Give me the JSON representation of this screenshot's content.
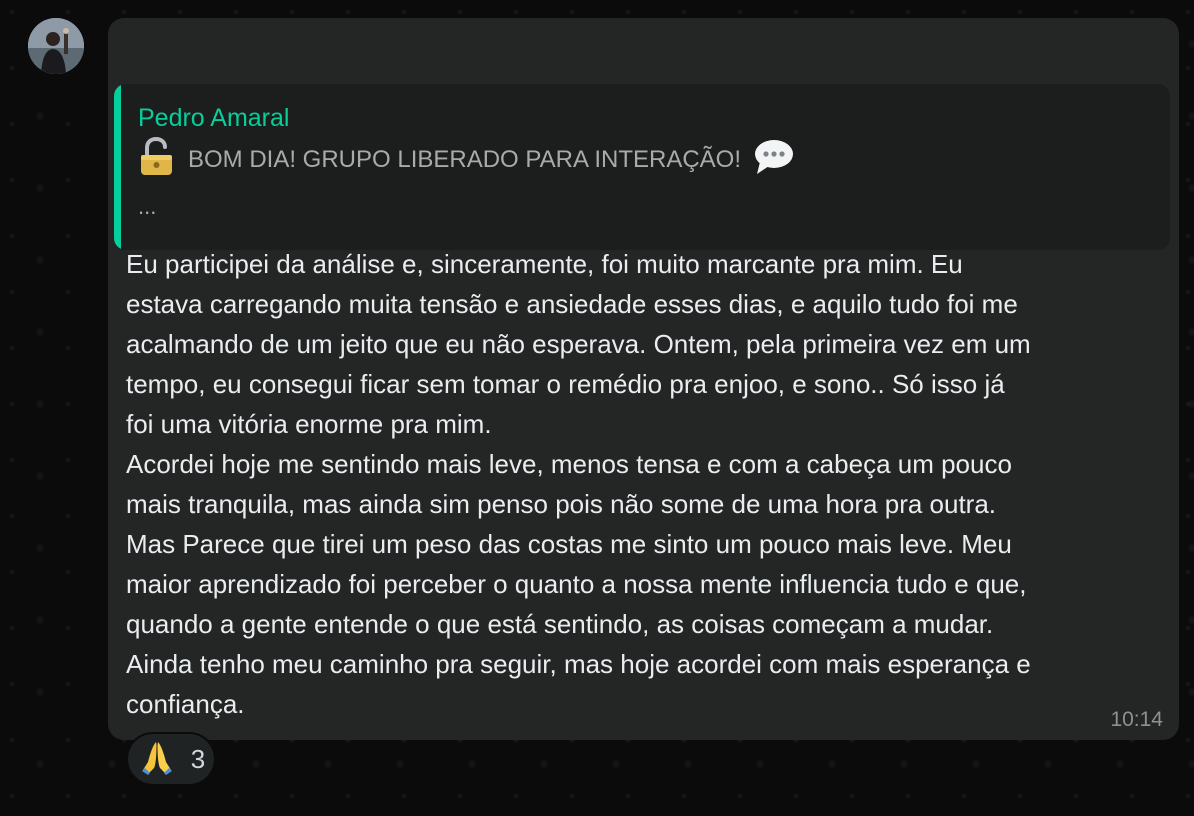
{
  "message": {
    "quote": {
      "author": "Pedro Amaral",
      "text": "BOM DIA! GRUPO LIBERADO PARA INTERAÇÃO!",
      "more": "..."
    },
    "text": "Eu participei da análise e, sinceramente, foi muito marcante pra mim. Eu\nestava carregando muita tensão e ansiedade esses dias, e aquilo tudo foi me\nacalmando de um jeito que eu não esperava. Ontem, pela primeira vez em um\ntempo, eu consegui ficar sem tomar o remédio pra enjoo, e sono.. Só isso já\nfoi uma vitória enorme pra mim.\nAcordei hoje me sentindo mais leve, menos tensa e com a cabeça um pouco\nmais tranquila, mas ainda sim penso pois não some de uma hora pra outra.\nMas Parece que tirei um peso das costas me sinto um pouco mais leve. Meu\nmaior aprendizado foi perceber o quanto a nossa mente influencia tudo e que,\nquando a gente entende o que está sentindo, as coisas começam a mudar.\nAinda tenho meu caminho pra seguir, mas hoje acordei com mais esperança e\nconfiança.",
    "time": "10:14",
    "reaction": {
      "emoji": "praying-hands",
      "count": "3"
    }
  },
  "icons": {
    "quote_leading": "unlocked-padlock",
    "quote_trailing": "speech-bubble"
  },
  "colors": {
    "background": "#0b0b0b",
    "bubble": "#242626",
    "quote_background": "#1c1e1e",
    "quote_accent": "#06cf9c",
    "text": "#e9edef",
    "secondary_text": "#a8abab",
    "timestamp": "#8d9191"
  }
}
